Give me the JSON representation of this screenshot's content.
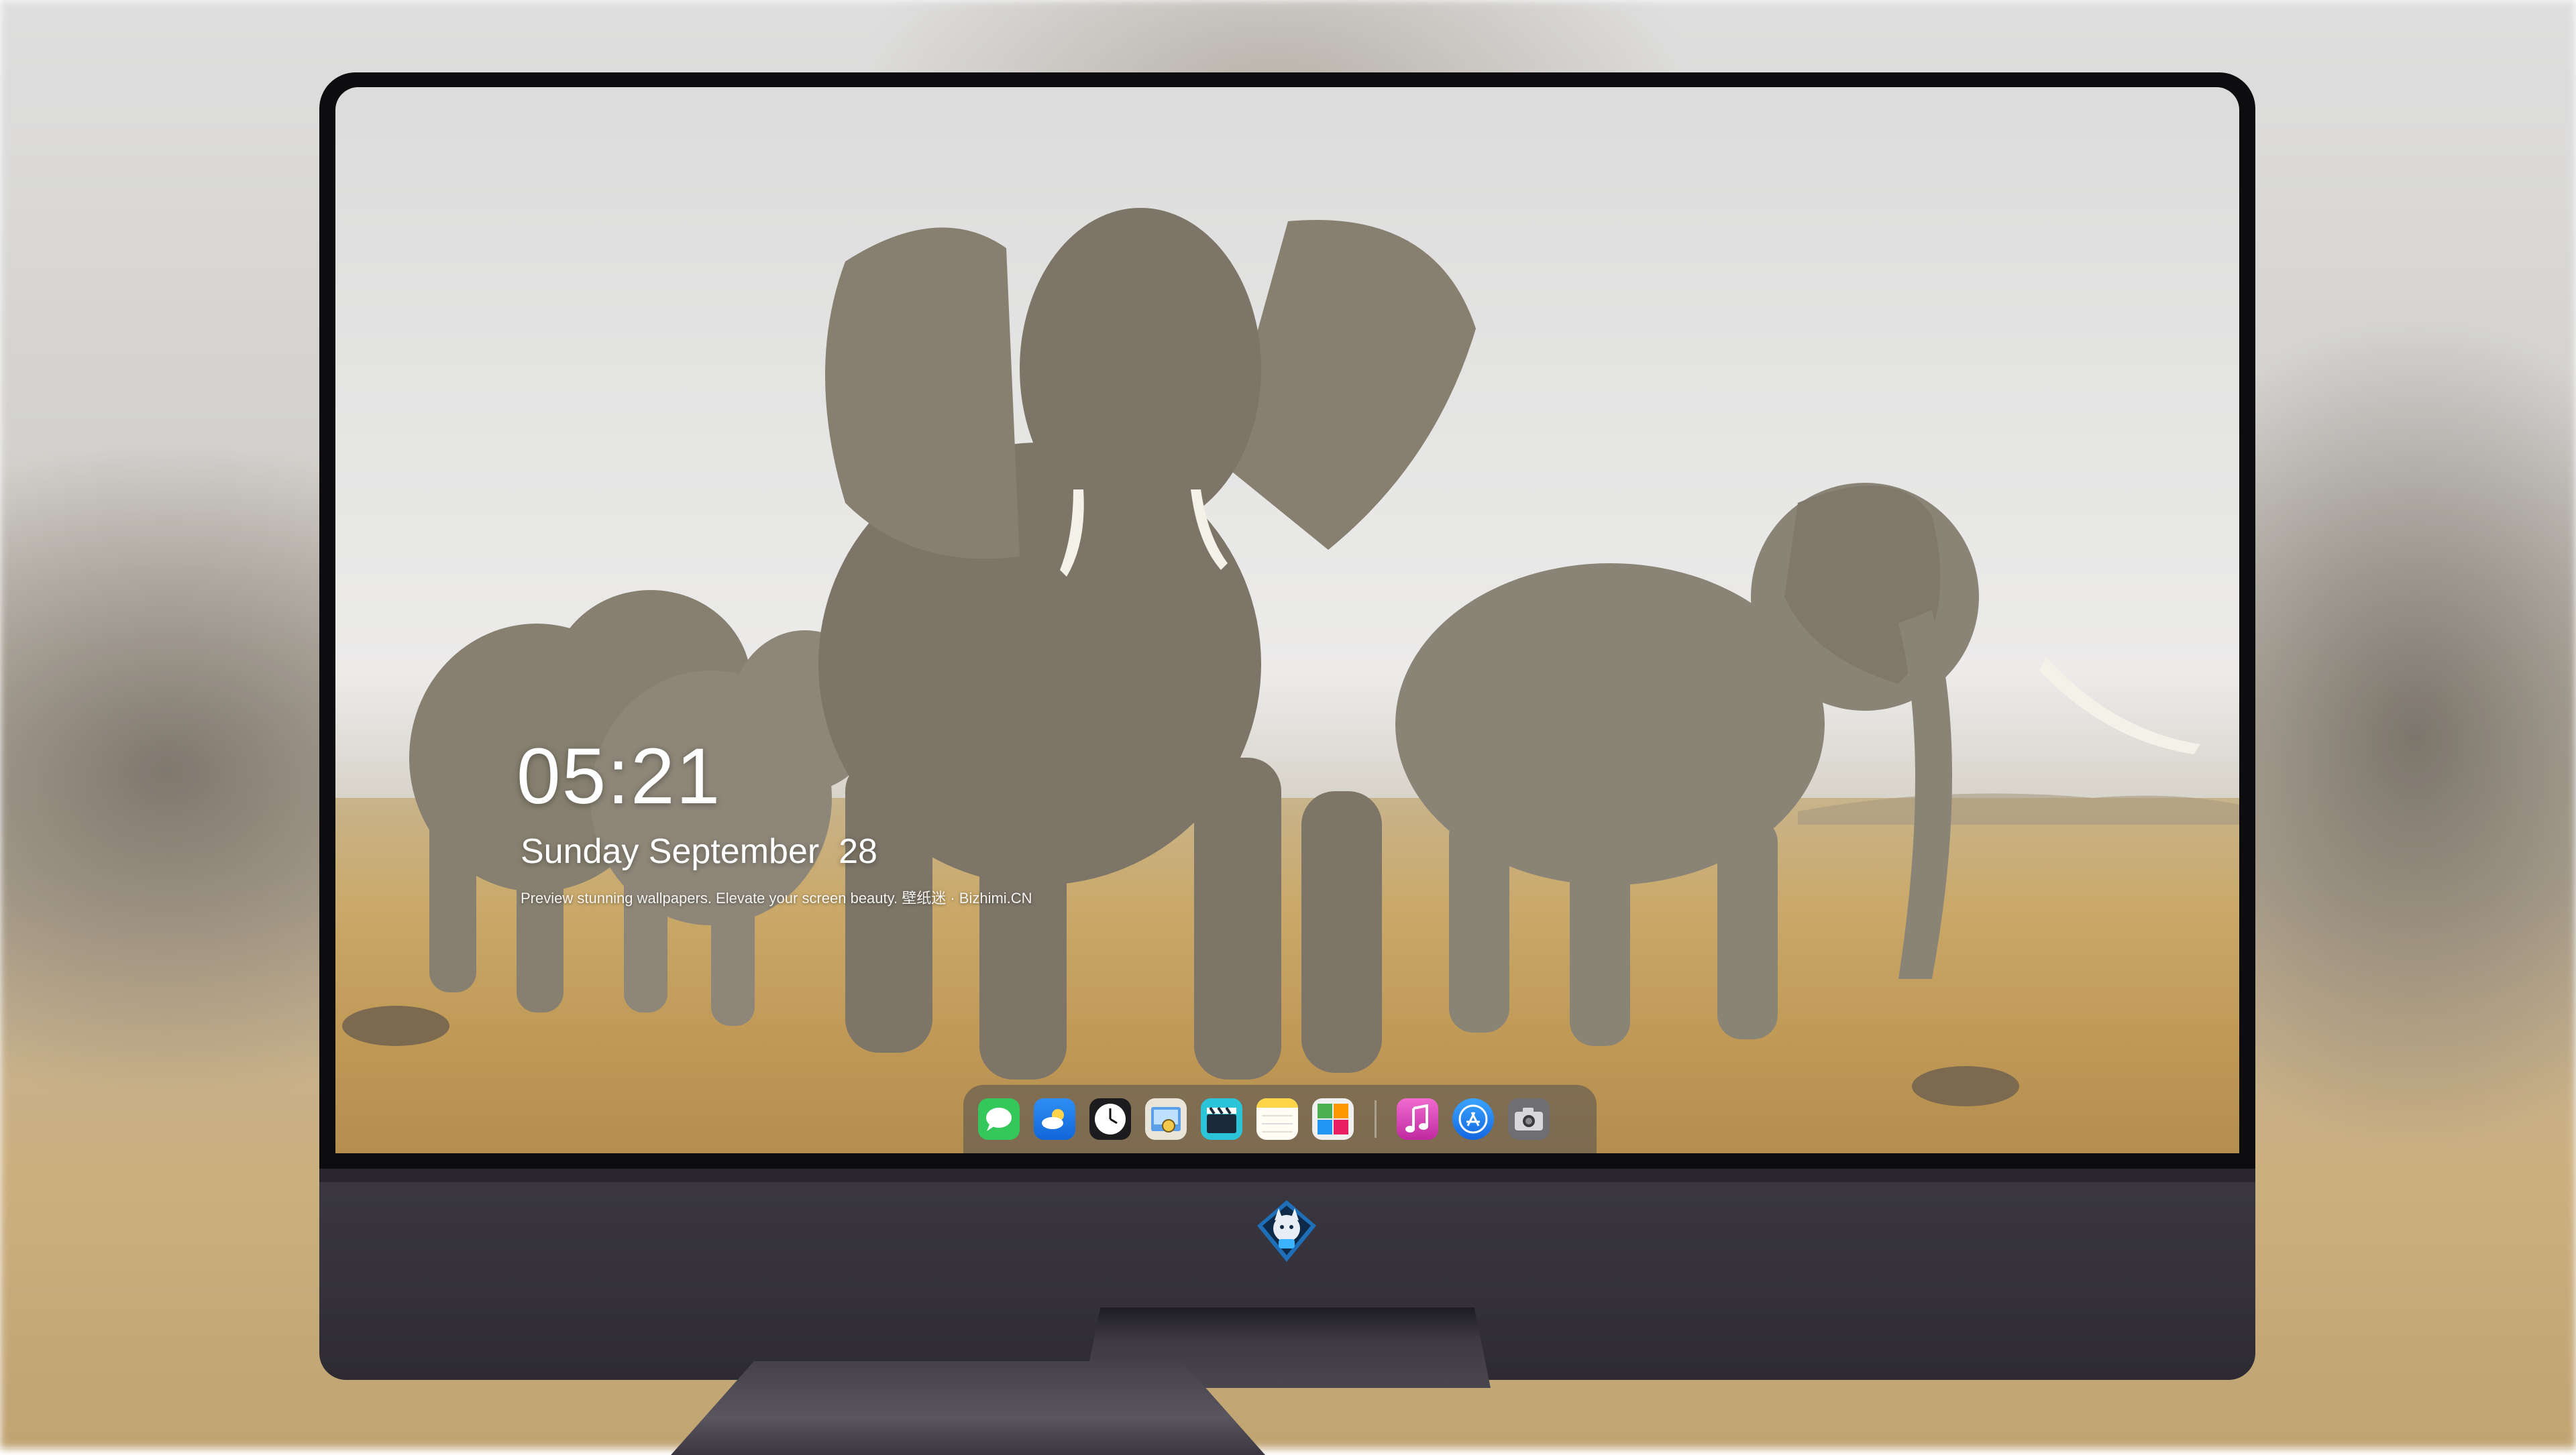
{
  "lock_screen": {
    "time": "05:21",
    "date": "Sunday September  28",
    "caption": "Preview stunning wallpapers. Elevate your screen beauty. 壁纸迷 · Bizhimi.CN"
  },
  "dock": {
    "apps": [
      {
        "name": "Messages",
        "icon": "messages-icon",
        "color": "#34c759"
      },
      {
        "name": "Weather",
        "icon": "weather-icon",
        "color": "#1e90ff"
      },
      {
        "name": "Clock",
        "icon": "clock-icon",
        "color": "#1c1c1e"
      },
      {
        "name": "Preview",
        "icon": "preview-icon",
        "color": "#f2c94c"
      },
      {
        "name": "Clips",
        "icon": "clapperboard-icon",
        "color": "#2cc4d8"
      },
      {
        "name": "Notes",
        "icon": "notes-icon",
        "color": "#ffd64a"
      },
      {
        "name": "Photo Browser",
        "icon": "photos-grid-icon",
        "color": "#eaeaea"
      },
      {
        "name": "Music",
        "icon": "music-note-icon",
        "color": "#e040a0"
      },
      {
        "name": "App Store",
        "icon": "app-store-icon",
        "color": "#1e88f5"
      },
      {
        "name": "Camera",
        "icon": "camera-icon",
        "color": "#6e6e73"
      }
    ]
  },
  "device": {
    "logo": "mascot-logo-icon"
  },
  "colors": {
    "bezel": "#0d0d0f",
    "chin": "#36333c",
    "sky": "#e6e6e5",
    "grass": "#c6a262",
    "elephant": "#8a8275"
  }
}
